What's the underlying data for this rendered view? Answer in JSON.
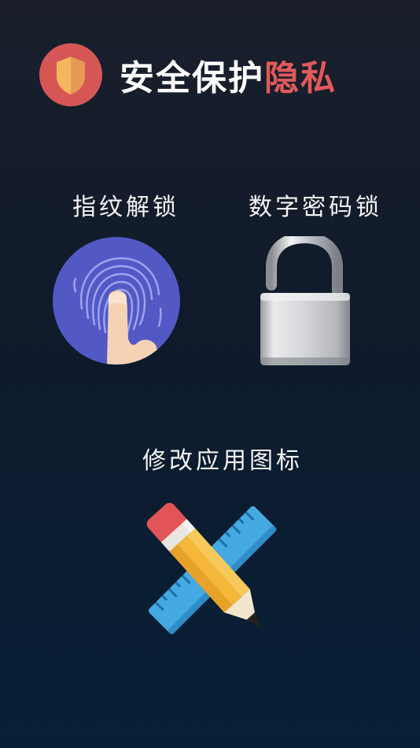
{
  "header": {
    "title_main": "安全保护",
    "title_accent": "隐私",
    "accent_color": "#e05a5a",
    "badge_color": "#d65656",
    "badge_icon": "shield-icon"
  },
  "features": {
    "fingerprint": {
      "label": "指纹解锁",
      "icon": "fingerprint-icon",
      "color": "#5259c4"
    },
    "pin": {
      "label": "数字密码锁",
      "icon": "padlock-icon"
    },
    "app_icon": {
      "label": "修改应用图标",
      "icon": "pencil-ruler-icon"
    }
  }
}
